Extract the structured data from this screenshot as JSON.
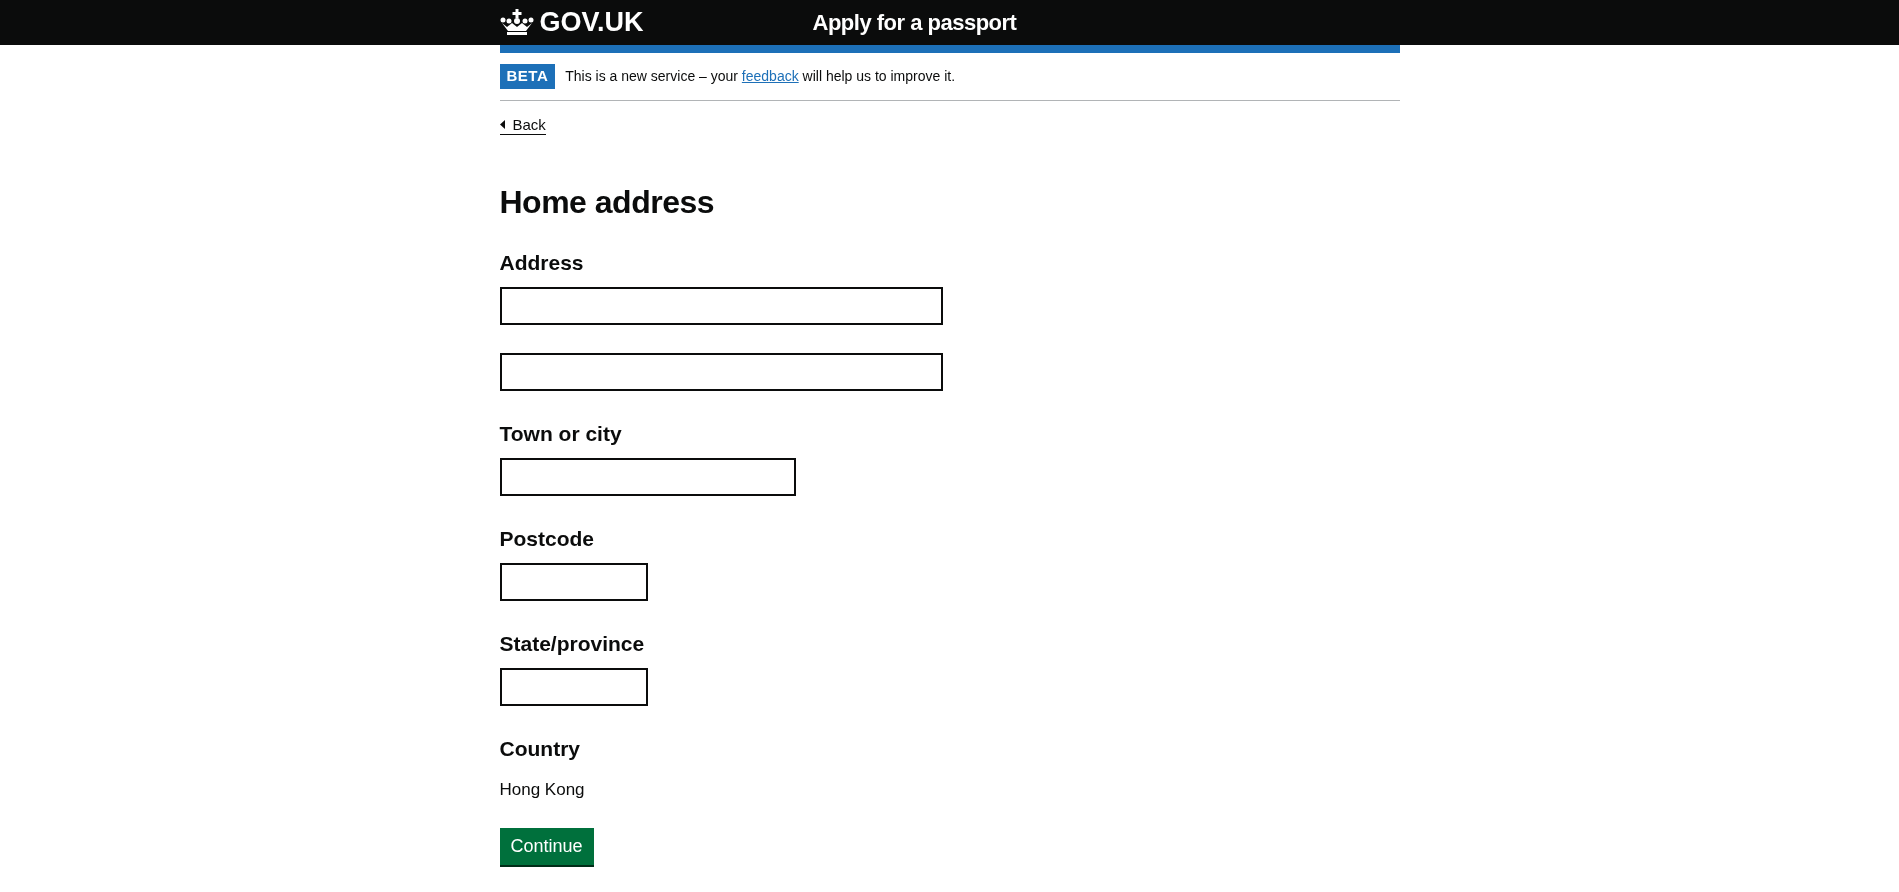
{
  "header": {
    "logo": "GOV.UK",
    "service": "Apply for a passport"
  },
  "phase_banner": {
    "tag": "BETA",
    "text_before": "This is a new service – your",
    "link": "feedback",
    "text_after": "will help us to improve it."
  },
  "back_link": "Back",
  "heading": "Home address",
  "fields": [
    {
      "label": "Address",
      "kind": "inputs",
      "inputs": [
        {
          "kind": "long"
        },
        {
          "kind": "long"
        }
      ]
    },
    {
      "label": "Town or city",
      "kind": "inputs",
      "inputs": [
        {
          "kind": "medium"
        }
      ]
    },
    {
      "label": "Postcode",
      "kind": "inputs",
      "inputs": [
        {
          "kind": "short"
        }
      ]
    },
    {
      "label": "State/province",
      "kind": "inputs",
      "inputs": [
        {
          "kind": "short"
        }
      ]
    },
    {
      "label": "Country",
      "kind": "static",
      "value": "Hong Kong"
    }
  ],
  "button": "Continue"
}
